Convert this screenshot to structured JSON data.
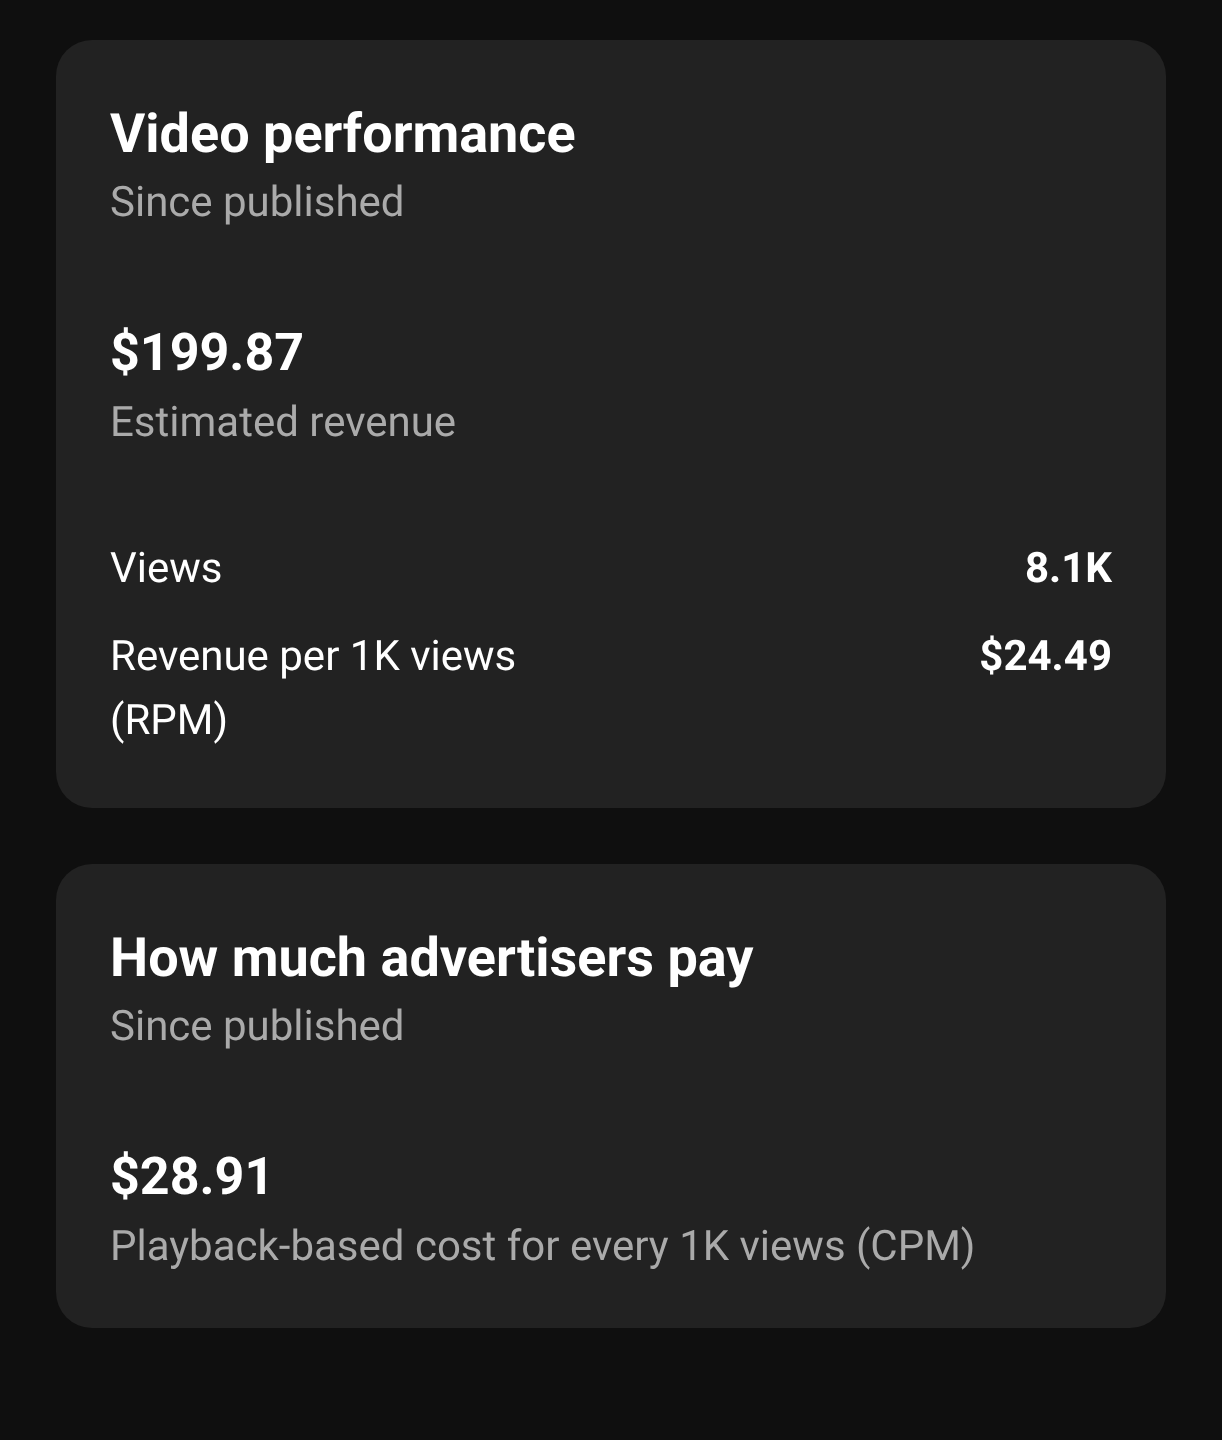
{
  "cards": [
    {
      "title": "Video performance",
      "subtitle": "Since published",
      "amount": "$199.87",
      "amount_label": "Estimated revenue",
      "rows": [
        {
          "label": "Views",
          "value": "8.1K"
        },
        {
          "label": "Revenue per 1K views (RPM)",
          "value": "$24.49"
        }
      ]
    },
    {
      "title": "How much advertisers pay",
      "subtitle": "Since published",
      "amount": "$28.91",
      "amount_label": "Playback-based cost for every 1K views (CPM)"
    }
  ]
}
